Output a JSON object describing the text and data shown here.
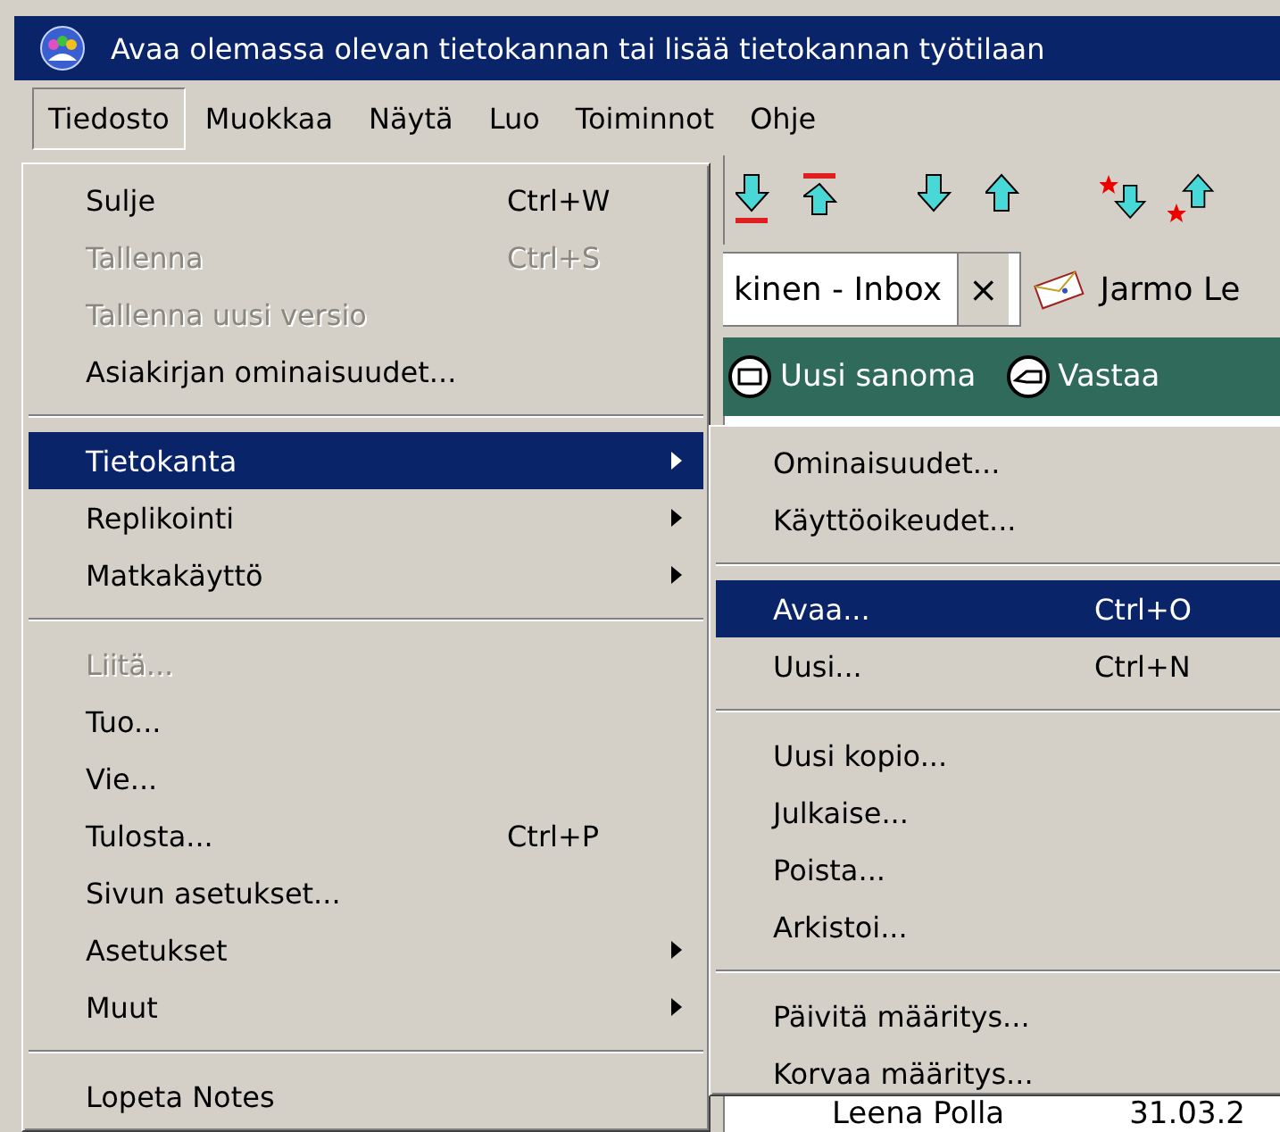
{
  "window": {
    "title": "Avaa olemassa olevan tietokannan tai lisää tietokannan työtilaan"
  },
  "menu_bar": [
    {
      "label": "Tiedosto",
      "selected": true
    },
    {
      "label": "Muokkaa",
      "selected": false
    },
    {
      "label": "Näytä",
      "selected": false
    },
    {
      "label": "Luo",
      "selected": false
    },
    {
      "label": "Toiminnot",
      "selected": false
    },
    {
      "label": "Ohje",
      "selected": false
    }
  ],
  "tabs": [
    {
      "label": "kinen - Inbox",
      "selected": true,
      "closable": true,
      "close": "×"
    },
    {
      "label": "Jarmo Le",
      "selected": false,
      "closable": false
    }
  ],
  "action_bar": [
    "Uusi sanoma",
    "Vastaa"
  ],
  "view_row": {
    "column_1": "Leena Polla",
    "column_2": "31.03.2"
  },
  "file_menu": [
    {
      "kind": "item",
      "label": "Sulje",
      "shortcut": "Ctrl+W",
      "disabled": false,
      "selected": false,
      "submenu": false
    },
    {
      "kind": "item",
      "label": "Tallenna",
      "shortcut": "Ctrl+S",
      "disabled": true,
      "selected": false,
      "submenu": false
    },
    {
      "kind": "item",
      "label": "Tallenna uusi versio",
      "disabled": true,
      "selected": false,
      "submenu": false
    },
    {
      "kind": "item",
      "label": "Asiakirjan ominaisuudet...",
      "disabled": false,
      "selected": false,
      "submenu": false
    },
    {
      "kind": "separator"
    },
    {
      "kind": "item",
      "label": "Tietokanta",
      "disabled": false,
      "selected": true,
      "submenu": true
    },
    {
      "kind": "item",
      "label": "Replikointi",
      "disabled": false,
      "selected": false,
      "submenu": true
    },
    {
      "kind": "item",
      "label": "Matkakäyttö",
      "disabled": false,
      "selected": false,
      "submenu": true
    },
    {
      "kind": "separator"
    },
    {
      "kind": "item",
      "label": "Liitä...",
      "disabled": true,
      "selected": false,
      "submenu": false
    },
    {
      "kind": "item",
      "label": "Tuo...",
      "disabled": false,
      "selected": false,
      "submenu": false
    },
    {
      "kind": "item",
      "label": "Vie...",
      "disabled": false,
      "selected": false,
      "submenu": false
    },
    {
      "kind": "item",
      "label": "Tulosta...",
      "shortcut": "Ctrl+P",
      "disabled": false,
      "selected": false,
      "submenu": false
    },
    {
      "kind": "item",
      "label": "Sivun asetukset...",
      "disabled": false,
      "selected": false,
      "submenu": false
    },
    {
      "kind": "item",
      "label": "Asetukset",
      "disabled": false,
      "selected": false,
      "submenu": true
    },
    {
      "kind": "item",
      "label": "Muut",
      "disabled": false,
      "selected": false,
      "submenu": true
    },
    {
      "kind": "separator"
    },
    {
      "kind": "item",
      "label": "Lopeta Notes",
      "disabled": false,
      "selected": false,
      "submenu": false
    }
  ],
  "database_submenu": [
    {
      "kind": "item",
      "label": "Ominaisuudet...",
      "disabled": false,
      "selected": false,
      "submenu": false
    },
    {
      "kind": "item",
      "label": "Käyttöoikeudet...",
      "disabled": false,
      "selected": false,
      "submenu": false
    },
    {
      "kind": "separator"
    },
    {
      "kind": "item",
      "label": "Avaa...",
      "shortcut": "Ctrl+O",
      "disabled": false,
      "selected": true,
      "submenu": false
    },
    {
      "kind": "item",
      "label": "Uusi...",
      "shortcut": "Ctrl+N",
      "disabled": false,
      "selected": false,
      "submenu": false
    },
    {
      "kind": "separator"
    },
    {
      "kind": "item",
      "label": "Uusi kopio...",
      "disabled": false,
      "selected": false,
      "submenu": false
    },
    {
      "kind": "item",
      "label": "Julkaise...",
      "disabled": false,
      "selected": false,
      "submenu": false
    },
    {
      "kind": "item",
      "label": "Poista...",
      "disabled": false,
      "selected": false,
      "submenu": false
    },
    {
      "kind": "item",
      "label": "Arkistoi...",
      "disabled": false,
      "selected": false,
      "submenu": false
    },
    {
      "kind": "separator"
    },
    {
      "kind": "item",
      "label": "Päivitä määritys...",
      "disabled": false,
      "selected": false,
      "submenu": false
    },
    {
      "kind": "item",
      "label": "Korvaa määritys...",
      "disabled": false,
      "selected": false,
      "submenu": false
    }
  ]
}
